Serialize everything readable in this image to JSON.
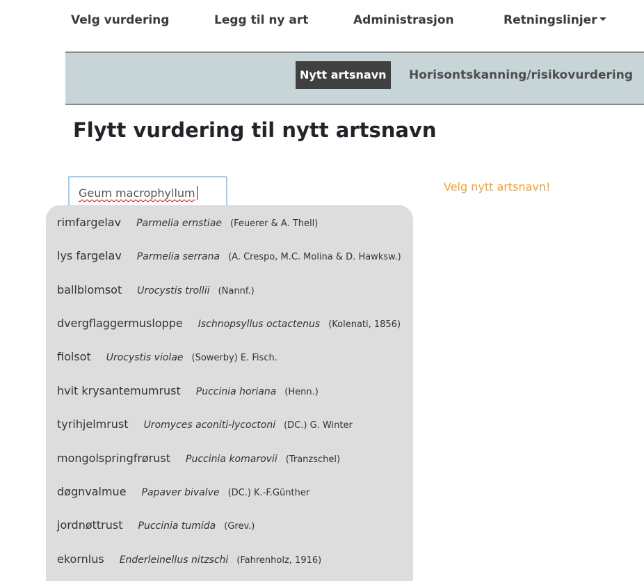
{
  "nav": {
    "items": [
      "Velg vurdering",
      "Legg til ny art",
      "Administrasjon"
    ],
    "dropdown_label": "Retningslinjer"
  },
  "subnav": {
    "active_tab": "Nytt artsnavn",
    "tab": "Horisontskanning/risikovurdering"
  },
  "page": {
    "title": "Flytt vurdering til nytt artsnavn",
    "hint": "Velg nytt artsnavn!"
  },
  "search": {
    "value": "Geum macrophyllum"
  },
  "suggestions": [
    {
      "common": "rimfargelav",
      "scientific": "Parmelia ernstiae",
      "author": "(Feuerer & A. Thell)"
    },
    {
      "common": "lys fargelav",
      "scientific": "Parmelia serrana",
      "author": "(A. Crespo, M.C. Molina & D. Hawksw.)"
    },
    {
      "common": "ballblomsot",
      "scientific": "Urocystis trollii",
      "author": "(Nannf.)"
    },
    {
      "common": "dvergflaggermusloppe",
      "scientific": "Ischnopsyllus octactenus",
      "author": "(Kolenati, 1856)"
    },
    {
      "common": "fiolsot",
      "scientific": "Urocystis violae",
      "author": "(Sowerby) E. Fisch."
    },
    {
      "common": "hvit krysantemumrust",
      "scientific": "Puccinia horiana",
      "author": "(Henn.)"
    },
    {
      "common": "tyrihjelmrust",
      "scientific": "Uromyces aconiti-lycoctoni",
      "author": "(DC.) G. Winter"
    },
    {
      "common": "mongolspringfrørust",
      "scientific": "Puccinia komarovii",
      "author": "(Tranzschel)"
    },
    {
      "common": "døgnvalmue",
      "scientific": "Papaver bivalve",
      "author": "(DC.) K.-F.Günther"
    },
    {
      "common": "jordnøttrust",
      "scientific": "Puccinia tumida",
      "author": "(Grev.)"
    },
    {
      "common": "ekornlus",
      "scientific": "Enderleinellus nitzschi",
      "author": "(Fahrenholz, 1916)"
    }
  ]
}
